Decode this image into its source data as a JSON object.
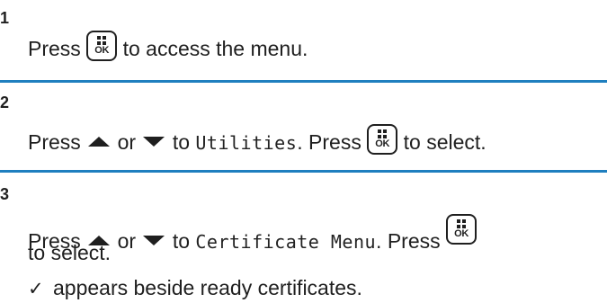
{
  "keys": {
    "ok_label": "OK"
  },
  "steps": [
    {
      "number": "1",
      "line1": {
        "before": "Press",
        "after": "to access the menu."
      }
    },
    {
      "number": "2",
      "line1": {
        "press": "Press",
        "or": "or",
        "to": "to",
        "menu_item": "Utilities",
        "period": ".",
        "press2": "Press",
        "after": "to select."
      }
    },
    {
      "number": "3",
      "line1": {
        "press": "Press",
        "or": "or",
        "to": "to",
        "menu_item": "Certificate Menu",
        "period": ".",
        "press2": "Press"
      },
      "line2": "to select.",
      "note": {
        "mark": "✓",
        "text": "appears beside ready certificates."
      }
    }
  ]
}
